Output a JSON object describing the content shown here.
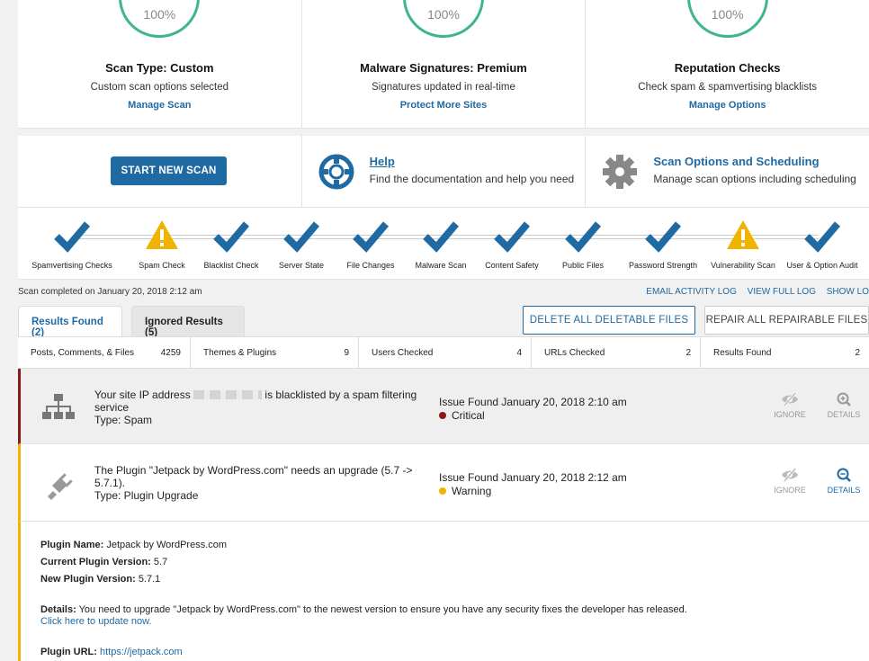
{
  "top_cards": [
    {
      "percent": "100%",
      "title": "Scan Type: Custom",
      "subtitle": "Custom scan options selected",
      "link": "Manage Scan"
    },
    {
      "percent": "100%",
      "title": "Malware Signatures: Premium",
      "subtitle": "Signatures updated in real-time",
      "link": "Protect More Sites"
    },
    {
      "percent": "100%",
      "title": "Reputation Checks",
      "subtitle": "Check spam & spamvertising blacklists",
      "link": "Manage Options"
    }
  ],
  "actions": {
    "start_button": "START NEW SCAN",
    "help": {
      "title": "Help",
      "description": "Find the documentation and help you need"
    },
    "options": {
      "title": "Scan Options and Scheduling",
      "description": "Manage scan options including scheduling"
    }
  },
  "steps": [
    {
      "label": "Spamvertising Checks",
      "status": "check"
    },
    {
      "label": "Spam Check",
      "status": "warning"
    },
    {
      "label": "Blacklist Check",
      "status": "check"
    },
    {
      "label": "Server State",
      "status": "check"
    },
    {
      "label": "File Changes",
      "status": "check"
    },
    {
      "label": "Malware Scan",
      "status": "check"
    },
    {
      "label": "Content Safety",
      "status": "check"
    },
    {
      "label": "Public Files",
      "status": "check"
    },
    {
      "label": "Password Strength",
      "status": "check"
    },
    {
      "label": "Vulnerability Scan",
      "status": "warning"
    },
    {
      "label": "User & Option Audit",
      "status": "check"
    }
  ],
  "scan_completed": "Scan completed on January 20, 2018 2:12 am",
  "log_links": {
    "email": "EMAIL ACTIVITY LOG",
    "full": "VIEW FULL LOG",
    "show": "SHOW LO"
  },
  "tabs": {
    "results": "Results Found (2)",
    "ignored": "Ignored Results (5)"
  },
  "bulk_buttons": {
    "delete": "DELETE ALL DELETABLE FILES",
    "repair": "REPAIR ALL REPAIRABLE FILES"
  },
  "summary": [
    {
      "label": "Posts, Comments, & Files",
      "value": "4259"
    },
    {
      "label": "Themes & Plugins",
      "value": "9"
    },
    {
      "label": "Users Checked",
      "value": "4"
    },
    {
      "label": "URLs Checked",
      "value": "2"
    },
    {
      "label": "Results Found",
      "value": "2"
    }
  ],
  "issues": [
    {
      "icon": "sitemap-icon",
      "message_pre": "Your site IP address",
      "message_post": "is blacklisted by a spam filtering",
      "message_line2": "service",
      "type": "Type: Spam",
      "found": "Issue Found January 20, 2018 2:10 am",
      "severity": "Critical",
      "severity_color": "#8b1a1a",
      "ignore": "IGNORE",
      "details": "DETAILS"
    },
    {
      "icon": "plug-icon",
      "message_line1": "The Plugin \"Jetpack by WordPress.com\" needs an upgrade (5.7 ->",
      "message_line2": "5.7.1).",
      "type": "Type: Plugin Upgrade",
      "found": "Issue Found January 20, 2018 2:12 am",
      "severity": "Warning",
      "severity_color": "#f0b400",
      "ignore": "IGNORE",
      "details": "DETAILS"
    }
  ],
  "detail": {
    "plugin_name_label": "Plugin Name:",
    "plugin_name": "Jetpack by WordPress.com",
    "current_label": "Current Plugin Version:",
    "current": "5.7",
    "new_label": "New Plugin Version:",
    "new": "5.7.1",
    "details_label": "Details:",
    "details_text": "You need to upgrade \"Jetpack by WordPress.com\" to the newest version to ensure you have any security fixes the developer has released.",
    "update_link": "Click here to update now.",
    "url_label": "Plugin URL:",
    "url": "https://jetpack.com"
  },
  "colors": {
    "accent": "#1f6aa3",
    "success": "#3fb58c",
    "warning": "#f0b400",
    "critical": "#8b1a1a"
  }
}
